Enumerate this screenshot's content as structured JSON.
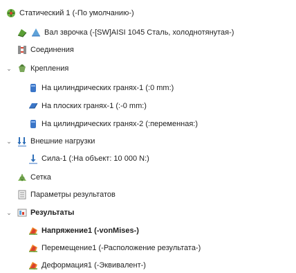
{
  "tree": {
    "root": {
      "label": "Статический 1 (-По умолчанию-)",
      "icon": "static-study-icon"
    },
    "part": {
      "label": "Вал зврочка (-[SW]AISI 1045 Сталь, холоднотянутая-)",
      "icon": "part-material-icon"
    },
    "connections": {
      "label": "Соединения",
      "icon": "connections-icon"
    },
    "fixtures": {
      "label": "Крепления",
      "icon": "fixtures-icon",
      "items": [
        {
          "label": "На цилиндрических гранях-1 (:0 mm:)",
          "icon": "cylindrical-fixture-icon"
        },
        {
          "label": "На плоских гранях-1 (:-0 mm:)",
          "icon": "planar-fixture-icon"
        },
        {
          "label": "На цилиндрических гранях-2 (:переменная:)",
          "icon": "cylindrical-fixture-icon"
        }
      ]
    },
    "external_loads": {
      "label": "Внешние нагрузки",
      "icon": "external-loads-icon",
      "items": [
        {
          "label": "Сила-1 (:На объект: 10 000 N:)",
          "icon": "force-icon"
        }
      ]
    },
    "mesh": {
      "label": "Сетка",
      "icon": "mesh-icon"
    },
    "result_options": {
      "label": "Параметры результатов",
      "icon": "result-options-icon"
    },
    "results": {
      "label": "Результаты",
      "icon": "results-folder-icon",
      "items": [
        {
          "label": "Напряжение1 (-vonMises-)",
          "icon": "stress-plot-icon",
          "bold": true
        },
        {
          "label": "Перемещение1 (-Расположение результата-)",
          "icon": "displacement-plot-icon",
          "bold": false
        },
        {
          "label": "Деформация1 (-Эквивалент-)",
          "icon": "strain-plot-icon",
          "bold": false
        }
      ]
    }
  },
  "colors": {
    "text": "#1f1f1f",
    "fixture_blue": "#3b76c8",
    "load_blue": "#2f6fb8",
    "green": "#64a23b",
    "red": "#d9412f",
    "gray": "#8e8e8e"
  }
}
